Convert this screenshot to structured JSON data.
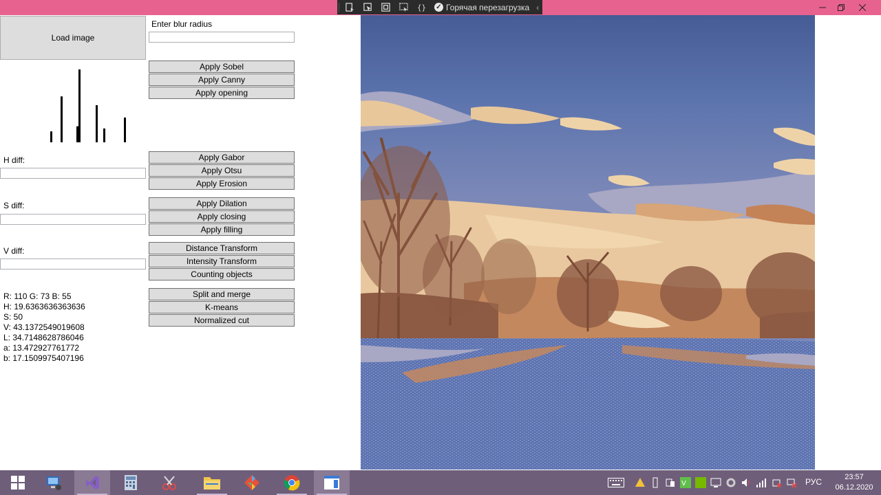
{
  "titlebar": {
    "hot_reload_label": "Горячая перезагрузка",
    "controls": [
      "minimize",
      "restore",
      "close"
    ],
    "accent_color": "#e8628f"
  },
  "left_panel": {
    "load_image_label": "Load image",
    "blur_label": "Enter blur radius",
    "blur_value": "",
    "h_diff_label": "H diff:",
    "h_diff_value": "",
    "s_diff_label": "S diff:",
    "s_diff_value": "",
    "v_diff_label": "V diff:",
    "v_diff_value": "",
    "histogram_bar_levels": [
      0.15,
      0.63,
      0.22,
      1.0,
      0.51,
      0.19,
      0.34
    ],
    "color_info": {
      "rgb": "R: 110 G: 73 B: 55",
      "h": "H: 19.6363636363636",
      "s": "S: 50",
      "v": "V: 43.1372549019608",
      "l": "L: 34.7148628786046",
      "a": "a: 13.472927761772",
      "b": "b: 17.1509975407196"
    }
  },
  "buttons": {
    "sobel": "Apply Sobel",
    "canny": "Apply Canny",
    "opening": "Apply opening",
    "gabor": "Apply Gabor",
    "otsu": "Apply Otsu",
    "erosion": "Apply Erosion",
    "dilation": "Apply Dilation",
    "closing": "Apply closing",
    "filling": "Apply filling",
    "distance": "Distance Transform",
    "intensity": "Intensity Transform",
    "counting": "Counting objects",
    "split_merge": "Split and merge",
    "kmeans": "K-means",
    "normalized_cut": "Normalized cut"
  },
  "taskbar": {
    "apps": [
      "windows-start",
      "remote-desktop",
      "visual-studio",
      "calculator",
      "snipping-tool",
      "file-explorer",
      "git",
      "chrome",
      "wpf-app"
    ],
    "language": "РУС",
    "time": "23:57",
    "date": "06.12.2020"
  }
}
